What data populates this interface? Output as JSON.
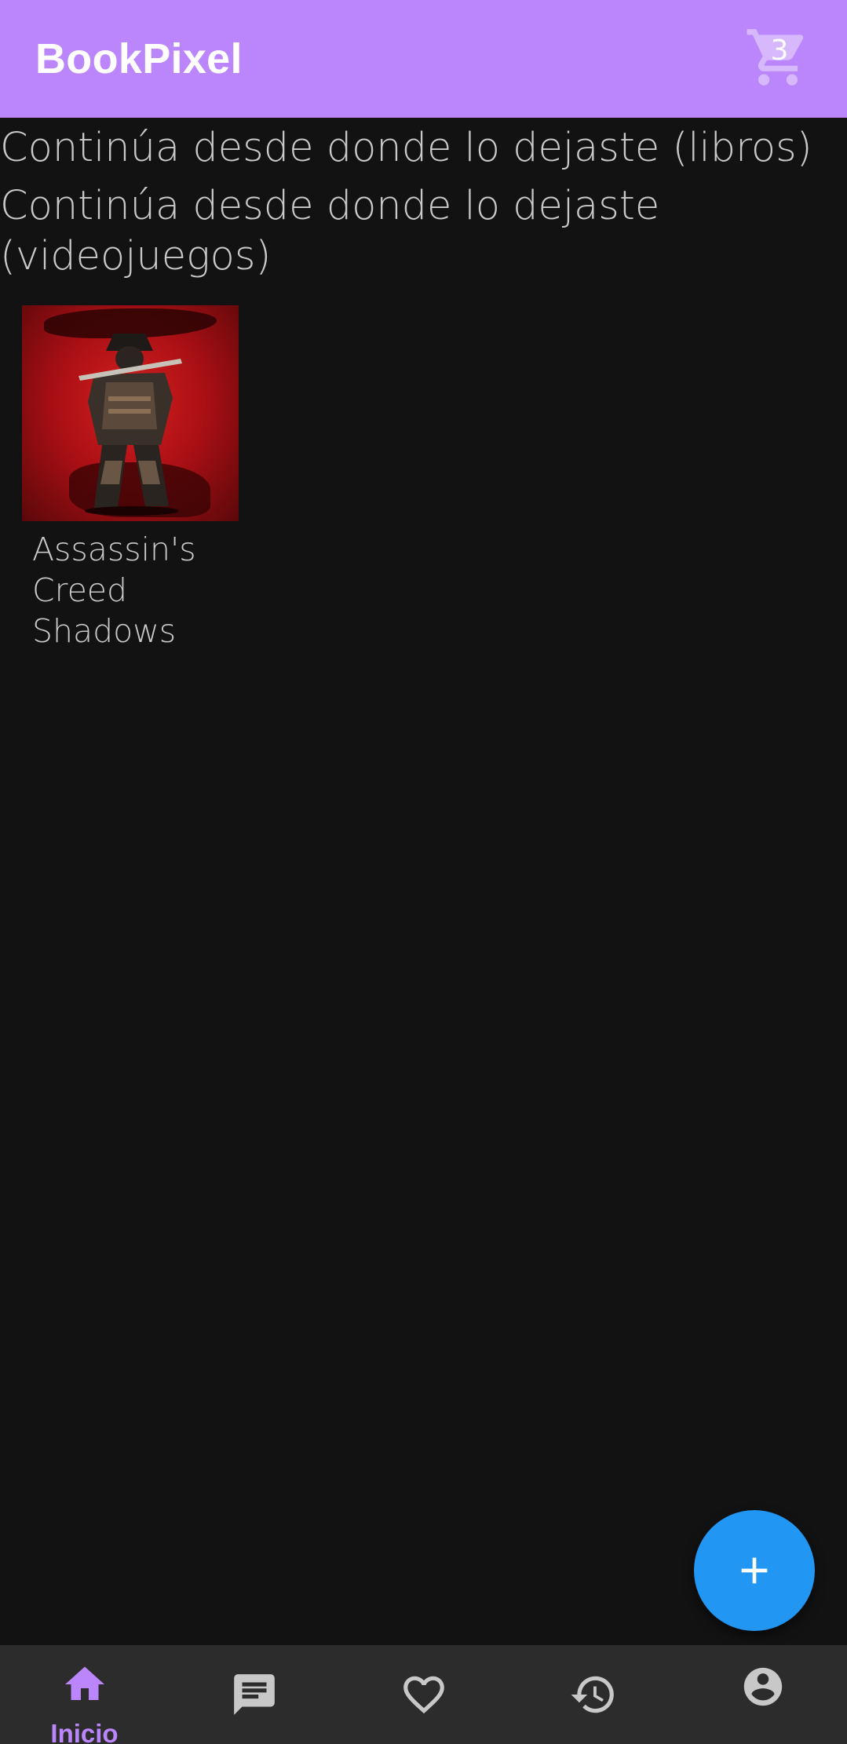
{
  "appbar": {
    "title": "BookPixel",
    "cart_icon": "shopping-cart-icon",
    "cart_count": "3",
    "background": "#bb86fc"
  },
  "sections": {
    "books_title": "Continúa desde donde lo dejaste (libros)",
    "games_title": "Continúa desde donde lo dejaste (videojuegos)"
  },
  "games": [
    {
      "title_lines": [
        "Assassin's",
        "Creed",
        "Shadows"
      ]
    }
  ],
  "fab": {
    "icon": "plus-icon",
    "color": "#2196f3"
  },
  "bottom_nav": {
    "items": [
      {
        "icon": "home-icon",
        "label": "Inicio",
        "active": true
      },
      {
        "icon": "chat-icon",
        "label": "",
        "active": false
      },
      {
        "icon": "heart-icon",
        "label": "",
        "active": false
      },
      {
        "icon": "history-icon",
        "label": "",
        "active": false
      },
      {
        "icon": "account-icon",
        "label": "",
        "active": false
      }
    ],
    "active_color": "#bb86fc",
    "inactive_color": "#c8c8c8"
  }
}
